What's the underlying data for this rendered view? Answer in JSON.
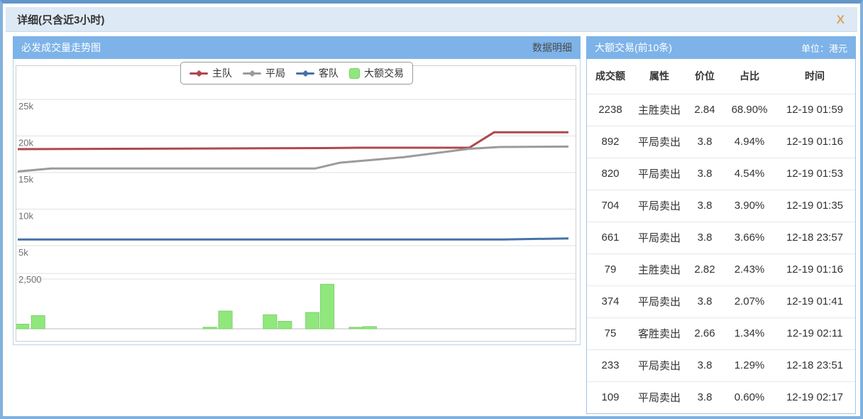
{
  "window": {
    "title": "详细(只含近3小时)",
    "close_label": "X"
  },
  "chart_panel": {
    "title": "必发成交量走势图",
    "detail_link": "数据明细",
    "legend": [
      {
        "label": "主队",
        "marker": "line",
        "color": "#b0484d"
      },
      {
        "label": "平局",
        "marker": "line",
        "color": "#9b9b9b"
      },
      {
        "label": "客队",
        "marker": "line",
        "color": "#4572a7"
      },
      {
        "label": "大额交易",
        "marker": "square",
        "color": "#90e87d"
      }
    ]
  },
  "chart_data": {
    "type": "line+bar",
    "y_unit": "港元",
    "grid": true,
    "legend_position": "top-center",
    "line_axis": {
      "ticks_k": [
        25,
        20,
        15,
        10,
        5
      ],
      "tick_labels": [
        "25k",
        "20k",
        "15k",
        "10k",
        "5k"
      ]
    },
    "bar_axis": {
      "tick_value": 2500,
      "tick_label": "2,500"
    },
    "series": [
      {
        "name": "主队",
        "type": "line",
        "color": "#b0484d",
        "points": [
          {
            "x": 0,
            "y": 18200
          },
          {
            "x": 0.56,
            "y": 18350
          },
          {
            "x": 0.62,
            "y": 18400
          },
          {
            "x": 0.82,
            "y": 18400
          },
          {
            "x": 0.865,
            "y": 20500
          },
          {
            "x": 1,
            "y": 20500
          }
        ]
      },
      {
        "name": "平局",
        "type": "line",
        "color": "#9b9b9b",
        "points": [
          {
            "x": 0,
            "y": 15150
          },
          {
            "x": 0.06,
            "y": 15550
          },
          {
            "x": 0.54,
            "y": 15550
          },
          {
            "x": 0.585,
            "y": 16350
          },
          {
            "x": 0.7,
            "y": 17100
          },
          {
            "x": 0.82,
            "y": 18250
          },
          {
            "x": 0.875,
            "y": 18500
          },
          {
            "x": 1,
            "y": 18550
          }
        ]
      },
      {
        "name": "客队",
        "type": "line",
        "color": "#4572a7",
        "points": [
          {
            "x": 0,
            "y": 5850
          },
          {
            "x": 0.88,
            "y": 5850
          },
          {
            "x": 1,
            "y": 6000
          }
        ]
      }
    ],
    "bar_series": {
      "name": "大额交易",
      "color": "#90e87d",
      "border_color": "#7ccf6b",
      "values": [
        233,
        661,
        79,
        892,
        704,
        374,
        820,
        2238,
        75,
        109
      ],
      "x_fractions": [
        0.008,
        0.037,
        0.349,
        0.377,
        0.458,
        0.485,
        0.535,
        0.562,
        0.614,
        0.639
      ]
    }
  },
  "table_panel": {
    "title": "大额交易(前10条)",
    "unit": "单位：港元",
    "columns": [
      "成交额",
      "属性",
      "价位",
      "占比",
      "时间"
    ],
    "rows": [
      [
        "2238",
        "主胜卖出",
        "2.84",
        "68.90%",
        "12-19 01:59"
      ],
      [
        "892",
        "平局卖出",
        "3.8",
        "4.94%",
        "12-19 01:16"
      ],
      [
        "820",
        "平局卖出",
        "3.8",
        "4.54%",
        "12-19 01:53"
      ],
      [
        "704",
        "平局卖出",
        "3.8",
        "3.90%",
        "12-19 01:35"
      ],
      [
        "661",
        "平局卖出",
        "3.8",
        "3.66%",
        "12-18 23:57"
      ],
      [
        "79",
        "主胜卖出",
        "2.82",
        "2.43%",
        "12-19 01:16"
      ],
      [
        "374",
        "平局卖出",
        "3.8",
        "2.07%",
        "12-19 01:41"
      ],
      [
        "75",
        "客胜卖出",
        "2.66",
        "1.34%",
        "12-19 02:11"
      ],
      [
        "233",
        "平局卖出",
        "3.8",
        "1.29%",
        "12-18 23:51"
      ],
      [
        "109",
        "平局卖出",
        "3.8",
        "0.60%",
        "12-19 02:17"
      ]
    ]
  },
  "colors": {
    "frame_border": "#81b1dd",
    "titlebar_bg": "#dde9f5",
    "panel_header_bg": "#7db3e8",
    "close_button": "#d9a662",
    "grid_line": "#e2e2e2",
    "axis_line": "#bdbdbd",
    "axis_label": "#707070",
    "row_divider": "#e3e8ef",
    "table_border": "#9ec6e8"
  }
}
